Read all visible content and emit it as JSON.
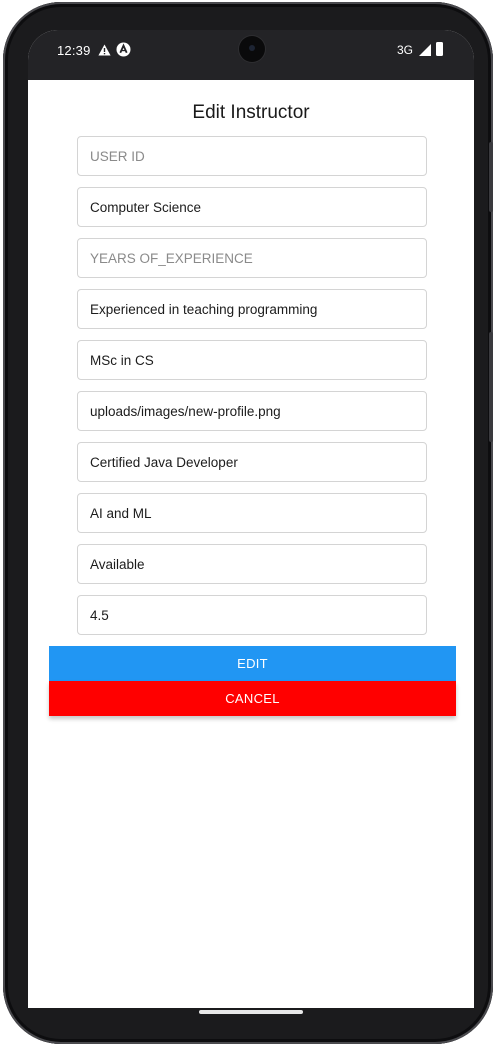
{
  "status_bar": {
    "time": "12:39",
    "network": "3G",
    "icons": [
      "warning-icon",
      "app-notification-icon",
      "signal-icon",
      "battery-icon"
    ]
  },
  "page": {
    "title": "Edit Instructor"
  },
  "form": {
    "fields": [
      {
        "name": "user-id-field",
        "value": "",
        "placeholder": "USER ID"
      },
      {
        "name": "department-field",
        "value": "Computer Science",
        "placeholder": ""
      },
      {
        "name": "years-of-experience-field",
        "value": "",
        "placeholder": "YEARS OF_EXPERIENCE"
      },
      {
        "name": "bio-field",
        "value": "Experienced in teaching programming",
        "placeholder": ""
      },
      {
        "name": "qualification-field",
        "value": "MSc in CS",
        "placeholder": ""
      },
      {
        "name": "profile-image-field",
        "value": "uploads/images/new-profile.png",
        "placeholder": ""
      },
      {
        "name": "certification-field",
        "value": "Certified Java Developer",
        "placeholder": ""
      },
      {
        "name": "specialization-field",
        "value": "AI and ML",
        "placeholder": ""
      },
      {
        "name": "availability-field",
        "value": "Available",
        "placeholder": ""
      },
      {
        "name": "rating-field",
        "value": "4.5",
        "placeholder": ""
      }
    ]
  },
  "actions": {
    "edit_label": "EDIT",
    "cancel_label": "CANCEL"
  },
  "colors": {
    "edit_button": "#2196F3",
    "cancel_button": "#FF0000",
    "status_bar": "#232326"
  }
}
